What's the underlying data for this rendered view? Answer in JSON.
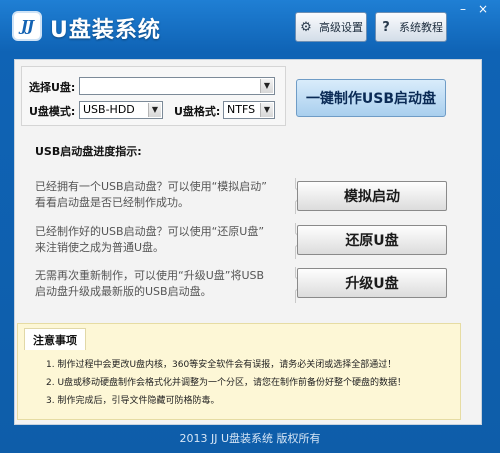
{
  "app": {
    "logo": "JJ",
    "title": "U盘装系统",
    "btn_advanced": "高级设置",
    "btn_tutorial": "系统教程",
    "win_min": "–",
    "win_close": "×"
  },
  "device": {
    "select_u_label": "选择U盘:",
    "select_u_value": "",
    "u_mode_label": "U盘模式:",
    "u_mode_value": "USB-HDD",
    "u_format_label": "U盘格式:",
    "u_format_value": "NTFS",
    "make_button": "一键制作USB启动盘"
  },
  "progress_label": "USB启动盘进度指示:",
  "rows": [
    {
      "line1": "已经拥有一个USB启动盘？可以使用“模拟启动”",
      "line2": "看看启动盘是否已经制作成功。",
      "button": "模拟启动"
    },
    {
      "line1": "已经制作好的USB启动盘？可以使用“还原U盘”",
      "line2": "来注销使之成为普通U盘。",
      "button": "还原U盘"
    },
    {
      "line1": "无需再次重新制作，可以使用“升级U盘”将USB",
      "line2": "启动盘升级成最新版的USB启动盘。",
      "button": "升级U盘"
    }
  ],
  "notes": {
    "title": "注意事项",
    "items": [
      "1. 制作过程中会更改U盘内核，360等安全软件会有误报，请务必关闭或选择全部通过！",
      "2. U盘或移动硬盘制作会格式化并调整为一个分区，请您在制作前备份好整个硬盘的数据！",
      "3. 制作完成后，引导文件隐藏可防格防毒。"
    ]
  },
  "footer": "2013 JJ U盘装系统 版权所有",
  "colors": {
    "window_blue": "#0f63b5",
    "notes_bg": "#fdf7d6",
    "primary_button": "#a9cfee"
  },
  "icons": {
    "advanced": "gear-icon",
    "tutorial": "help-icon",
    "dropdown": "chevron-down-icon"
  }
}
